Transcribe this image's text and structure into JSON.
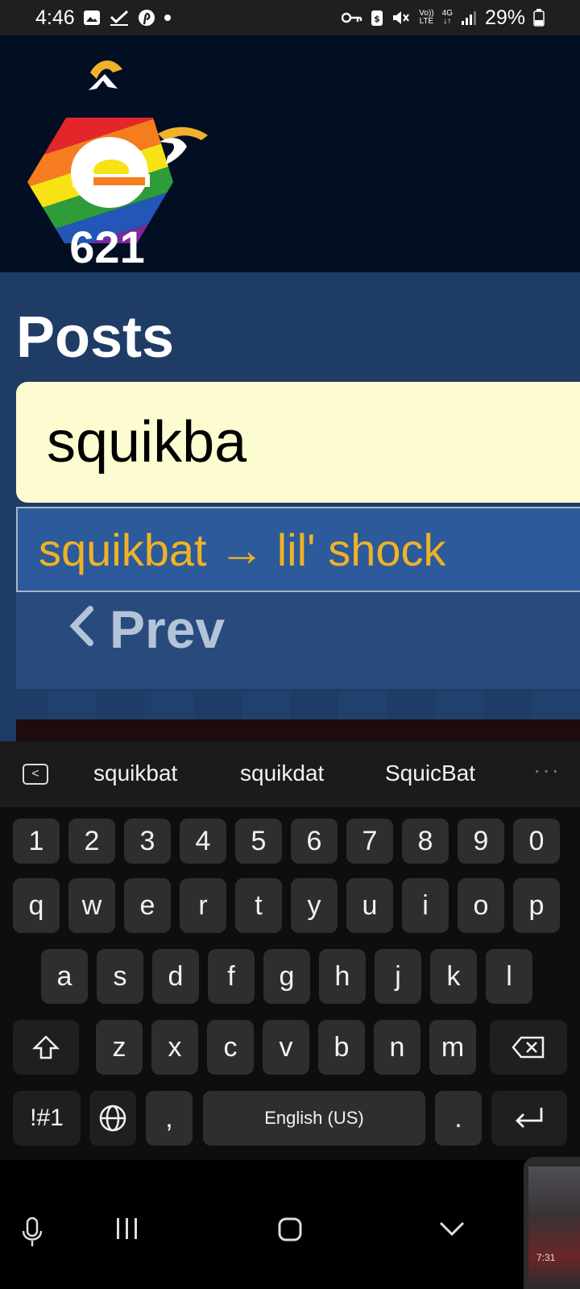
{
  "status_bar": {
    "time": "4:46",
    "battery": "29%",
    "network_top": "Vo))",
    "network_bottom": "LTE",
    "gen_top": "4G",
    "gen_bottom": "↓↑"
  },
  "page": {
    "title": "Posts",
    "logo_text": "621"
  },
  "search": {
    "value": "squikba"
  },
  "autocomplete": {
    "suggestion": "squikbat → lil' shock"
  },
  "pagination": {
    "prev_label": "Prev"
  },
  "keyboard": {
    "suggestions": [
      "squikbat",
      "squikdat",
      "SquicBat"
    ],
    "more": "···",
    "row_numbers": [
      "1",
      "2",
      "3",
      "4",
      "5",
      "6",
      "7",
      "8",
      "9",
      "0"
    ],
    "row_top": [
      "q",
      "w",
      "e",
      "r",
      "t",
      "y",
      "u",
      "i",
      "o",
      "p"
    ],
    "row_mid": [
      "a",
      "s",
      "d",
      "f",
      "g",
      "h",
      "j",
      "k",
      "l"
    ],
    "row_bottom": [
      "z",
      "x",
      "c",
      "v",
      "b",
      "n",
      "m"
    ],
    "symbols_label": "!#1",
    "comma": ",",
    "space_label": "English (US)",
    "period": "."
  },
  "pip": {
    "time": "7:31"
  },
  "colors": {
    "header_bg": "#020f23",
    "content_bg": "#1f3c67",
    "search_bg": "#fdfcd0",
    "suggestion_bg": "#2c5a9a",
    "suggestion_text": "#efb226"
  }
}
